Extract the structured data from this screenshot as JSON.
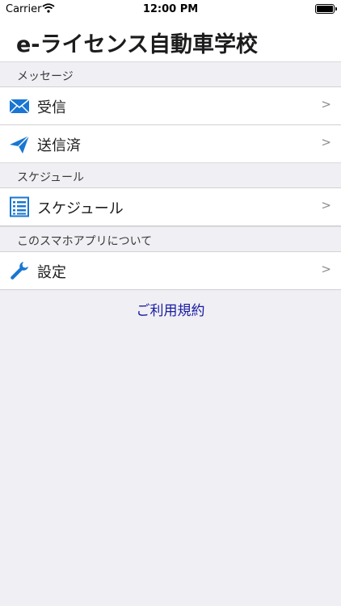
{
  "status_bar": {
    "carrier": "Carrier",
    "time": "12:00 PM",
    "wifi_icon": "wifi-icon",
    "battery_icon": "battery-icon"
  },
  "nav": {
    "title": "e-ライセンス自動車学校"
  },
  "sections": [
    {
      "header": "メッセージ",
      "items": [
        {
          "label": "受信",
          "icon": "envelope-icon",
          "chevron": ">"
        },
        {
          "label": "送信済",
          "icon": "paper-plane-icon",
          "chevron": ">"
        }
      ]
    },
    {
      "header": "スケジュール",
      "items": [
        {
          "label": "スケジュール",
          "icon": "list-icon",
          "chevron": ">"
        }
      ]
    },
    {
      "header": "このスマホアプリについて",
      "items": [
        {
          "label": "設定",
          "icon": "wrench-icon",
          "chevron": ">"
        }
      ]
    }
  ],
  "footer": {
    "terms_link": "ご利用規約"
  },
  "colors": {
    "icon_blue": "#1976d2",
    "link": "#1a1aa0",
    "background": "#efeff4"
  }
}
